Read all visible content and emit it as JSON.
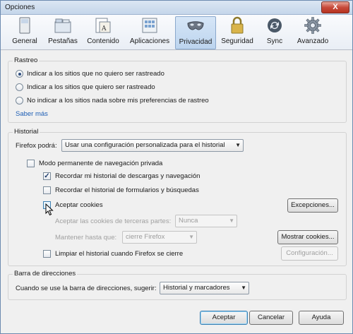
{
  "window": {
    "title": "Opciones",
    "close_label": "X"
  },
  "toolbar": [
    {
      "label": "General",
      "icon": "general-icon"
    },
    {
      "label": "Pestañas",
      "icon": "tabs-icon"
    },
    {
      "label": "Contenido",
      "icon": "content-icon"
    },
    {
      "label": "Aplicaciones",
      "icon": "applications-icon"
    },
    {
      "label": "Privacidad",
      "icon": "privacy-mask-icon",
      "active": true
    },
    {
      "label": "Seguridad",
      "icon": "padlock-icon"
    },
    {
      "label": "Sync",
      "icon": "sync-icon"
    },
    {
      "label": "Avanzado",
      "icon": "gear-icon"
    }
  ],
  "tracking": {
    "title": "Rastreo",
    "options": [
      {
        "label": "Indicar a los sitios que no quiero ser rastreado",
        "selected": true
      },
      {
        "label": "Indicar a los sitios que quiero ser rastreado",
        "selected": false
      },
      {
        "label": "No indicar a los sitios nada sobre mis preferencias de rastreo",
        "selected": false
      }
    ],
    "learn_more": "Saber más"
  },
  "history": {
    "title": "Historial",
    "firefox_label": "Firefox podrá:",
    "firefox_value": "Usar una configuración personalizada para el historial",
    "private_mode": {
      "label": "Modo permanente de navegación privada",
      "checked": false
    },
    "remember_downloads": {
      "label": "Recordar mi historial de descargas y navegación",
      "checked": true
    },
    "remember_forms": {
      "label": "Recordar el historial de formularios y búsquedas",
      "checked": false
    },
    "accept_cookies": {
      "label": "Aceptar cookies",
      "checked": false
    },
    "exceptions_button": "Excepciones...",
    "third_party_label": "Aceptar las cookies de terceras partes:",
    "third_party_value": "Nunca",
    "keep_until_label": "Mantener hasta que:",
    "keep_until_value": "cierre Firefox",
    "show_cookies_button": "Mostrar cookies...",
    "clear_history": {
      "label": "Limpiar el historial cuando Firefox se cierre",
      "checked": false
    },
    "settings_button": "Configuración..."
  },
  "address_bar": {
    "title": "Barra de direcciones",
    "label": "Cuando se use la barra de direcciones, sugerir:",
    "value": "Historial y marcadores"
  },
  "footer": {
    "accept": "Aceptar",
    "cancel": "Cancelar",
    "help": "Ayuda"
  }
}
